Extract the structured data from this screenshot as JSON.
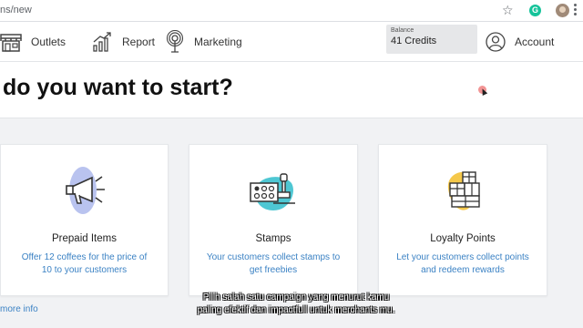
{
  "browser": {
    "url": "ns/new"
  },
  "nav": {
    "outlets": "Outlets",
    "report": "Report",
    "marketing": "Marketing",
    "balance_caption": "Balance",
    "balance_value": "41 Credits",
    "account": "Account"
  },
  "hero": {
    "title": "do you want to start?"
  },
  "cards": [
    {
      "title": "Prepaid Items",
      "desc_1": "Offer 12 coffees for the price of",
      "desc_2": "10 to your customers"
    },
    {
      "title": "Stamps",
      "desc_1": "Your customers collect stamps to",
      "desc_2": "get freebies"
    },
    {
      "title": "Loyalty Points",
      "desc_1": "Let your customers collect points",
      "desc_2": "and redeem rewards"
    }
  ],
  "more_info": "more info",
  "subtitle": {
    "line1": "Pilih salah satu campaign yang menurut kamu",
    "line2": "paling efektif dan impactfull untuk merchants mu."
  },
  "colors": {
    "link": "#3b82c4",
    "prepaid_blob": "#b9c3ef",
    "stamps_blob": "#4ec7d3",
    "loyalty_blob": "#f5c84a"
  }
}
